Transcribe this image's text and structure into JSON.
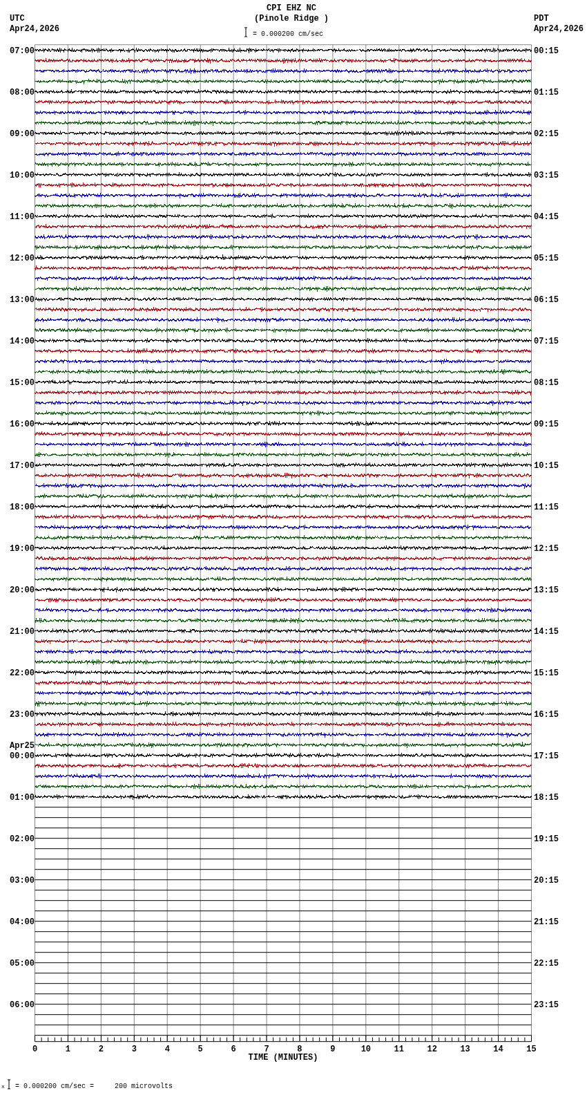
{
  "header": {
    "station": "CPI EHZ NC",
    "location": "(Pinole Ridge )",
    "scale": "= 0.000200 cm/sec"
  },
  "left": {
    "zone": "UTC",
    "date": "Apr24,2026"
  },
  "right": {
    "zone": "PDT",
    "date": "Apr24,2026"
  },
  "hours": [
    {
      "utc": "07:00",
      "pdt": "00:15",
      "traces": [
        {
          "color": "#000000"
        },
        {
          "color": "#cc0000"
        },
        {
          "color": "#0000cc"
        },
        {
          "color": "#006400"
        }
      ]
    },
    {
      "utc": "08:00",
      "pdt": "01:15",
      "traces": [
        {
          "color": "#000000"
        },
        {
          "color": "#cc0000"
        },
        {
          "color": "#0000cc"
        },
        {
          "color": "#006400"
        }
      ]
    },
    {
      "utc": "09:00",
      "pdt": "02:15",
      "traces": [
        {
          "color": "#000000"
        },
        {
          "color": "#cc0000"
        },
        {
          "color": "#0000cc"
        },
        {
          "color": "#006400"
        }
      ]
    },
    {
      "utc": "10:00",
      "pdt": "03:15",
      "traces": [
        {
          "color": "#000000"
        },
        {
          "color": "#cc0000"
        },
        {
          "color": "#0000cc"
        },
        {
          "color": "#006400"
        }
      ]
    },
    {
      "utc": "11:00",
      "pdt": "04:15",
      "traces": [
        {
          "color": "#000000"
        },
        {
          "color": "#cc0000"
        },
        {
          "color": "#0000cc"
        },
        {
          "color": "#006400"
        }
      ]
    },
    {
      "utc": "12:00",
      "pdt": "05:15",
      "traces": [
        {
          "color": "#000000"
        },
        {
          "color": "#cc0000"
        },
        {
          "color": "#0000cc"
        },
        {
          "color": "#006400"
        }
      ]
    },
    {
      "utc": "13:00",
      "pdt": "06:15",
      "traces": [
        {
          "color": "#000000"
        },
        {
          "color": "#cc0000"
        },
        {
          "color": "#0000cc"
        },
        {
          "color": "#006400"
        }
      ]
    },
    {
      "utc": "14:00",
      "pdt": "07:15",
      "traces": [
        {
          "color": "#000000"
        },
        {
          "color": "#cc0000"
        },
        {
          "color": "#0000cc"
        },
        {
          "color": "#006400"
        }
      ]
    },
    {
      "utc": "15:00",
      "pdt": "08:15",
      "traces": [
        {
          "color": "#000000"
        },
        {
          "color": "#cc0000"
        },
        {
          "color": "#0000cc"
        },
        {
          "color": "#006400"
        }
      ]
    },
    {
      "utc": "16:00",
      "pdt": "09:15",
      "traces": [
        {
          "color": "#000000"
        },
        {
          "color": "#cc0000"
        },
        {
          "color": "#0000cc"
        },
        {
          "color": "#006400"
        }
      ]
    },
    {
      "utc": "17:00",
      "pdt": "10:15",
      "traces": [
        {
          "color": "#000000"
        },
        {
          "color": "#cc0000"
        },
        {
          "color": "#0000cc"
        },
        {
          "color": "#006400"
        }
      ]
    },
    {
      "utc": "18:00",
      "pdt": "11:15",
      "traces": [
        {
          "color": "#000000"
        },
        {
          "color": "#cc0000"
        },
        {
          "color": "#0000cc"
        },
        {
          "color": "#006400"
        }
      ]
    },
    {
      "utc": "19:00",
      "pdt": "12:15",
      "traces": [
        {
          "color": "#000000"
        },
        {
          "color": "#cc0000"
        },
        {
          "color": "#0000cc"
        },
        {
          "color": "#006400"
        }
      ]
    },
    {
      "utc": "20:00",
      "pdt": "13:15",
      "traces": [
        {
          "color": "#000000"
        },
        {
          "color": "#cc0000"
        },
        {
          "color": "#0000cc"
        },
        {
          "color": "#006400"
        }
      ]
    },
    {
      "utc": "21:00",
      "pdt": "14:15",
      "traces": [
        {
          "color": "#000000"
        },
        {
          "color": "#cc0000"
        },
        {
          "color": "#0000cc"
        },
        {
          "color": "#006400"
        }
      ]
    },
    {
      "utc": "22:00",
      "pdt": "15:15",
      "traces": [
        {
          "color": "#000000"
        },
        {
          "color": "#cc0000"
        },
        {
          "color": "#0000cc"
        },
        {
          "color": "#006400"
        }
      ]
    },
    {
      "utc": "23:00",
      "pdt": "16:15",
      "traces": [
        {
          "color": "#000000"
        },
        {
          "color": "#cc0000"
        },
        {
          "color": "#0000cc"
        },
        {
          "color": "#006400"
        }
      ]
    },
    {
      "date": "Apr25",
      "utc": "00:00",
      "pdt": "17:15",
      "traces": [
        {
          "color": "#000000"
        },
        {
          "color": "#cc0000"
        },
        {
          "color": "#0000cc"
        },
        {
          "color": "#006400"
        }
      ]
    },
    {
      "utc": "01:00",
      "pdt": "18:15",
      "traces": [
        {
          "color": "#000000"
        }
      ]
    },
    {
      "utc": "02:00",
      "pdt": "19:15"
    },
    {
      "utc": "03:00",
      "pdt": "20:15"
    },
    {
      "utc": "04:00",
      "pdt": "21:15"
    },
    {
      "utc": "05:00",
      "pdt": "22:15"
    },
    {
      "utc": "06:00",
      "pdt": "23:15"
    }
  ],
  "axis": {
    "ticks": [
      "0",
      "1",
      "2",
      "3",
      "4",
      "5",
      "6",
      "7",
      "8",
      "9",
      "10",
      "11",
      "12",
      "13",
      "14",
      "15"
    ],
    "label": "TIME (MINUTES)"
  },
  "footer": {
    "mark": "x",
    "text": "= 0.000200 cm/sec =     200 microvolts"
  }
}
